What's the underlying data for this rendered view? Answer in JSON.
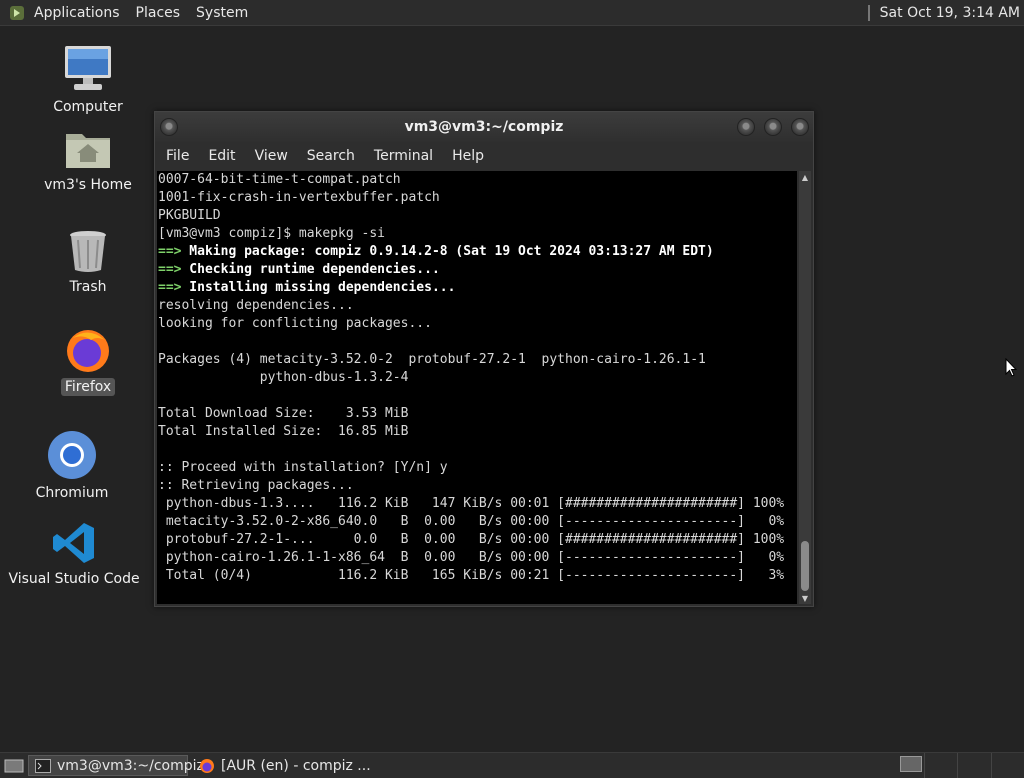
{
  "top_panel": {
    "menus": [
      "Applications",
      "Places",
      "System"
    ],
    "clock": "Sat Oct 19,  3:14 AM"
  },
  "desktop": {
    "icons": [
      {
        "label": "Computer",
        "icon": "computer-icon"
      },
      {
        "label": "vm3's Home",
        "icon": "home-folder-icon"
      },
      {
        "label": "Trash",
        "icon": "trash-icon"
      },
      {
        "label": "Firefox",
        "icon": "firefox-icon",
        "selected": true
      },
      {
        "label": "Chromium",
        "icon": "chromium-icon"
      },
      {
        "label": "Visual Studio Code",
        "icon": "vscode-icon"
      }
    ]
  },
  "window": {
    "title": "vm3@vm3:~/compiz",
    "menu": [
      "File",
      "Edit",
      "View",
      "Search",
      "Terminal",
      "Help"
    ]
  },
  "terminal": {
    "lines": [
      {
        "text": "0007-64-bit-time-t-compat.patch"
      },
      {
        "text": "1001-fix-crash-in-vertexbuffer.patch"
      },
      {
        "text": "PKGBUILD"
      },
      {
        "text": "[vm3@vm3 compiz]$ makepkg -si"
      },
      {
        "arrow": "==>",
        "text": " Making package: compiz 0.9.14.2-8 (Sat 19 Oct 2024 03:13:27 AM EDT)"
      },
      {
        "arrow": "==>",
        "text": " Checking runtime dependencies..."
      },
      {
        "arrow": "==>",
        "text": " Installing missing dependencies..."
      },
      {
        "text": "resolving dependencies..."
      },
      {
        "text": "looking for conflicting packages..."
      },
      {
        "text": ""
      },
      {
        "text": "Packages (4) metacity-3.52.0-2  protobuf-27.2-1  python-cairo-1.26.1-1"
      },
      {
        "text": "             python-dbus-1.3.2-4"
      },
      {
        "text": ""
      },
      {
        "text": "Total Download Size:    3.53 MiB"
      },
      {
        "text": "Total Installed Size:  16.85 MiB"
      },
      {
        "text": ""
      },
      {
        "text": ":: Proceed with installation? [Y/n] y"
      },
      {
        "text": ":: Retrieving packages..."
      },
      {
        "text": " python-dbus-1.3....   116.2 KiB   147 KiB/s 00:01 [######################] 100%"
      },
      {
        "text": " metacity-3.52.0-2-x86_640.0   B  0.00   B/s 00:00 [----------------------]   0%"
      },
      {
        "text": " protobuf-27.2-1-...     0.0   B  0.00   B/s 00:00 [######################] 100%"
      },
      {
        "text": " python-cairo-1.26.1-1-x86_64  B  0.00   B/s 00:00 [----------------------]   0%"
      },
      {
        "text": " Total (0/4)           116.2 KiB   165 KiB/s 00:21 [----------------------]   3%"
      }
    ]
  },
  "taskbar": {
    "tasks": [
      {
        "label": "vm3@vm3:~/compiz",
        "icon": "terminal-icon",
        "active": true
      },
      {
        "label": "[AUR (en) - compiz ...",
        "icon": "firefox-icon",
        "active": false
      }
    ]
  }
}
